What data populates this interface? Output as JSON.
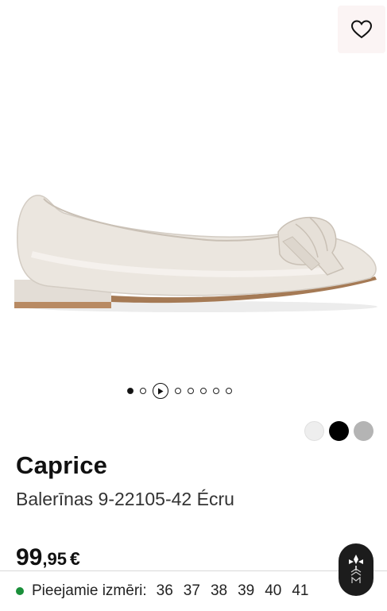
{
  "product": {
    "brand": "Caprice",
    "name": "Balerīnas 9-22105-42 Écru",
    "price_main": "99",
    "price_decimals": ",95",
    "currency": "€"
  },
  "gallery": {
    "image_alt": "Ecru leather ballet flat with knotted bow",
    "dots_before_play": 2,
    "active_index": 0,
    "dots_after_play": 5
  },
  "color_swatches": [
    {
      "name": "ecru",
      "color": "#eeeeee"
    },
    {
      "name": "black",
      "color": "#000000"
    },
    {
      "name": "grey",
      "color": "#b4b4b4"
    }
  ],
  "sizes": {
    "label": "Pieejamie izmēri:",
    "values": [
      "36",
      "37",
      "38",
      "39",
      "40",
      "41"
    ]
  },
  "icons": {
    "wishlist": "heart-icon",
    "video": "play-icon",
    "assistant": "brand-badge-icon"
  },
  "colors": {
    "available": "#1a8f3a",
    "wishlist_bg": "#fbf4f4"
  }
}
